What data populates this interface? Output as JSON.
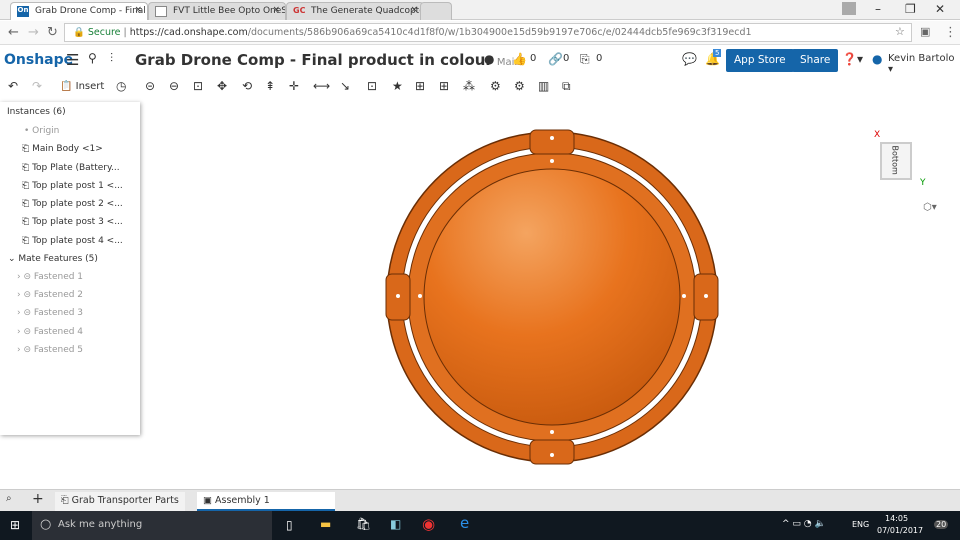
{
  "browser": {
    "tabs": [
      {
        "label": "Grab Drone Comp - Final product in colour",
        "icon": "On"
      },
      {
        "label": "FVT Little Bee Opto OneShot",
        "icon": "doc"
      },
      {
        "label": "The Generate Quadcopter",
        "icon": "GC"
      }
    ],
    "url_secure": "Secure",
    "url_host": "https://cad.onshape.com",
    "url_path": "/documents/586b906a69ca5410c4d1f8f0/w/1b304900e15d59b9197e706c/e/02444dcb5fe969c3f319ecd1"
  },
  "header": {
    "logo": "Onshape",
    "title": "Grab Drone Comp - Final product in colour",
    "branch": "Main",
    "likes": "0",
    "links": "0",
    "copies": "0",
    "notifications": "5",
    "app_store": "App Store",
    "share": "Share",
    "user": "Kevin Bartolo"
  },
  "toolbar": {
    "insert": "Insert"
  },
  "panel": {
    "instances_header": "Instances (6)",
    "origin": "Origin",
    "instances": [
      "Main Body <1>",
      "Top Plate (Battery...",
      "Top plate post 1 <...",
      "Top plate post 2 <...",
      "Top plate post 3 <...",
      "Top plate post 4 <..."
    ],
    "mates_header": "Mate Features (5)",
    "mates": [
      "Fastened 1",
      "Fastened 2",
      "Fastened 3",
      "Fastened 4",
      "Fastened 5"
    ]
  },
  "viewcube": {
    "face": "Bottom",
    "x": "X",
    "y": "Y"
  },
  "model": {
    "color": "#e8731e"
  },
  "bottom_tabs": [
    "Grab Transporter Parts",
    "Assembly 1"
  ],
  "taskbar": {
    "search": "Ask me anything",
    "time": "14:05",
    "date": "07/01/2017",
    "lang": "ENG",
    "notif": "20"
  }
}
